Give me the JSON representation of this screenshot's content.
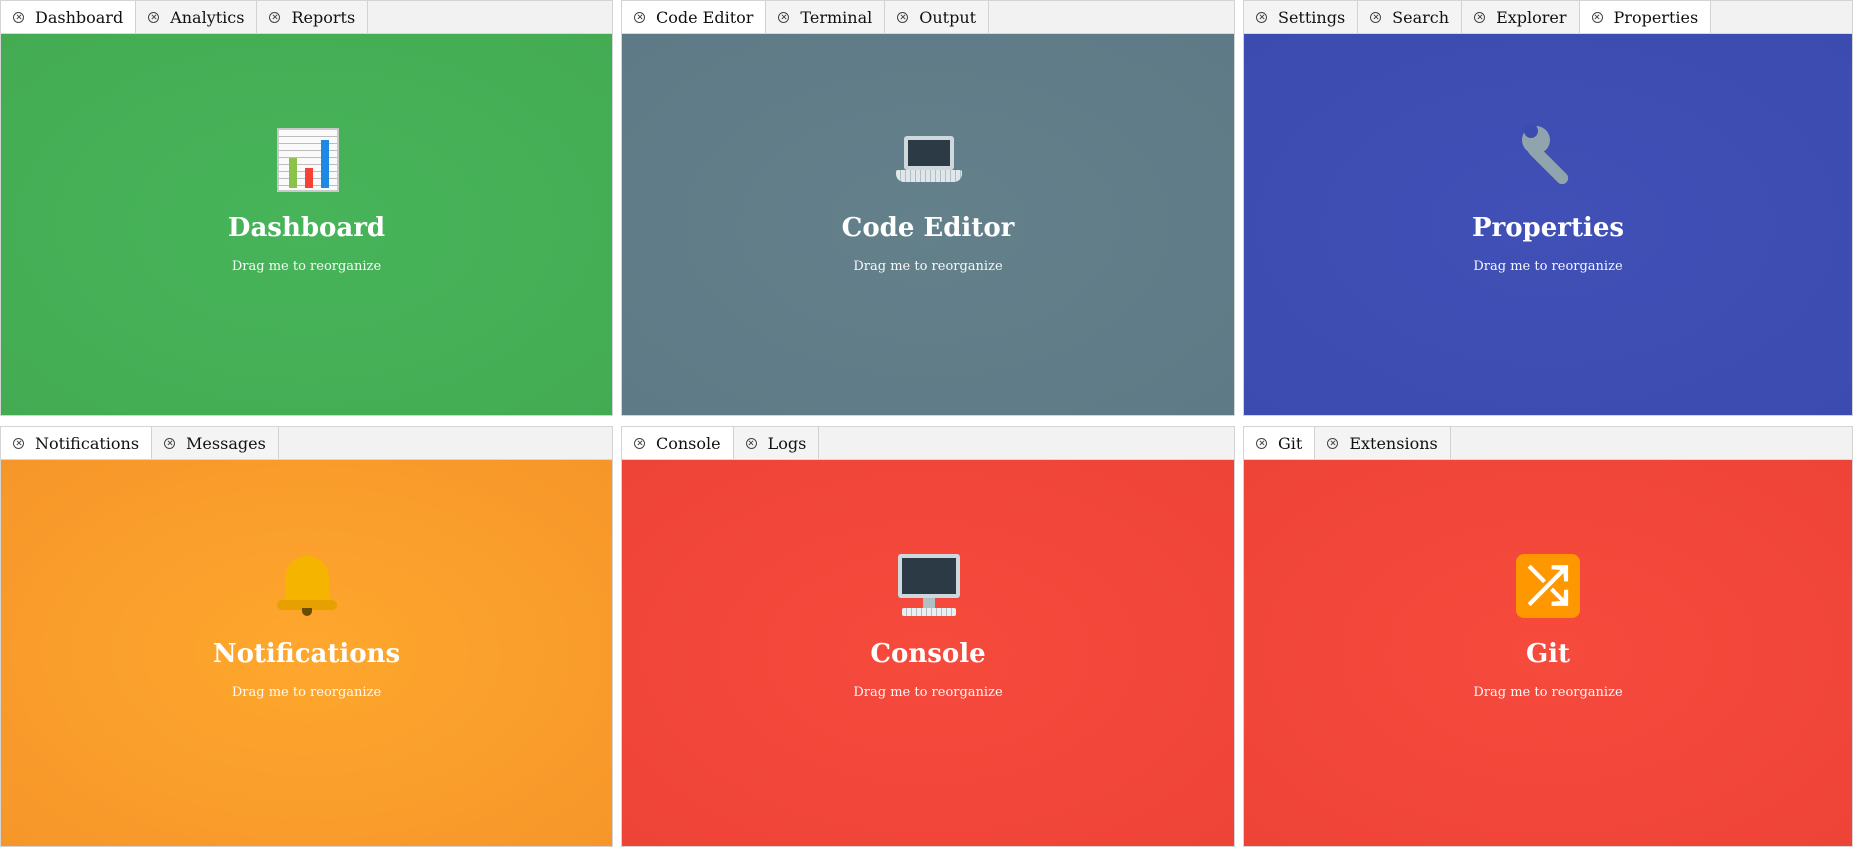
{
  "hint_text": "Drag me to reorganize",
  "panels": [
    {
      "tabs": [
        "Dashboard",
        "Analytics",
        "Reports"
      ],
      "active_tab": "Dashboard",
      "title": "Dashboard",
      "icon": "bar-chart-icon",
      "color": "#45b058"
    },
    {
      "tabs": [
        "Code Editor",
        "Terminal",
        "Output"
      ],
      "active_tab": "Code Editor",
      "title": "Code Editor",
      "icon": "laptop-icon",
      "color": "#607d8b"
    },
    {
      "tabs": [
        "Settings",
        "Search",
        "Explorer",
        "Properties"
      ],
      "active_tab": "Properties",
      "title": "Properties",
      "icon": "wrench-icon",
      "color": "#3f51b5"
    },
    {
      "tabs": [
        "Notifications",
        "Messages"
      ],
      "active_tab": "Notifications",
      "title": "Notifications",
      "icon": "bell-icon",
      "color": "#ff9f2b"
    },
    {
      "tabs": [
        "Console",
        "Logs"
      ],
      "active_tab": "Console",
      "title": "Console",
      "icon": "desktop-computer-icon",
      "color": "#f44336"
    },
    {
      "tabs": [
        "Git",
        "Extensions"
      ],
      "active_tab": "Git",
      "title": "Git",
      "icon": "shuffle-icon",
      "color": "#f44336"
    }
  ]
}
